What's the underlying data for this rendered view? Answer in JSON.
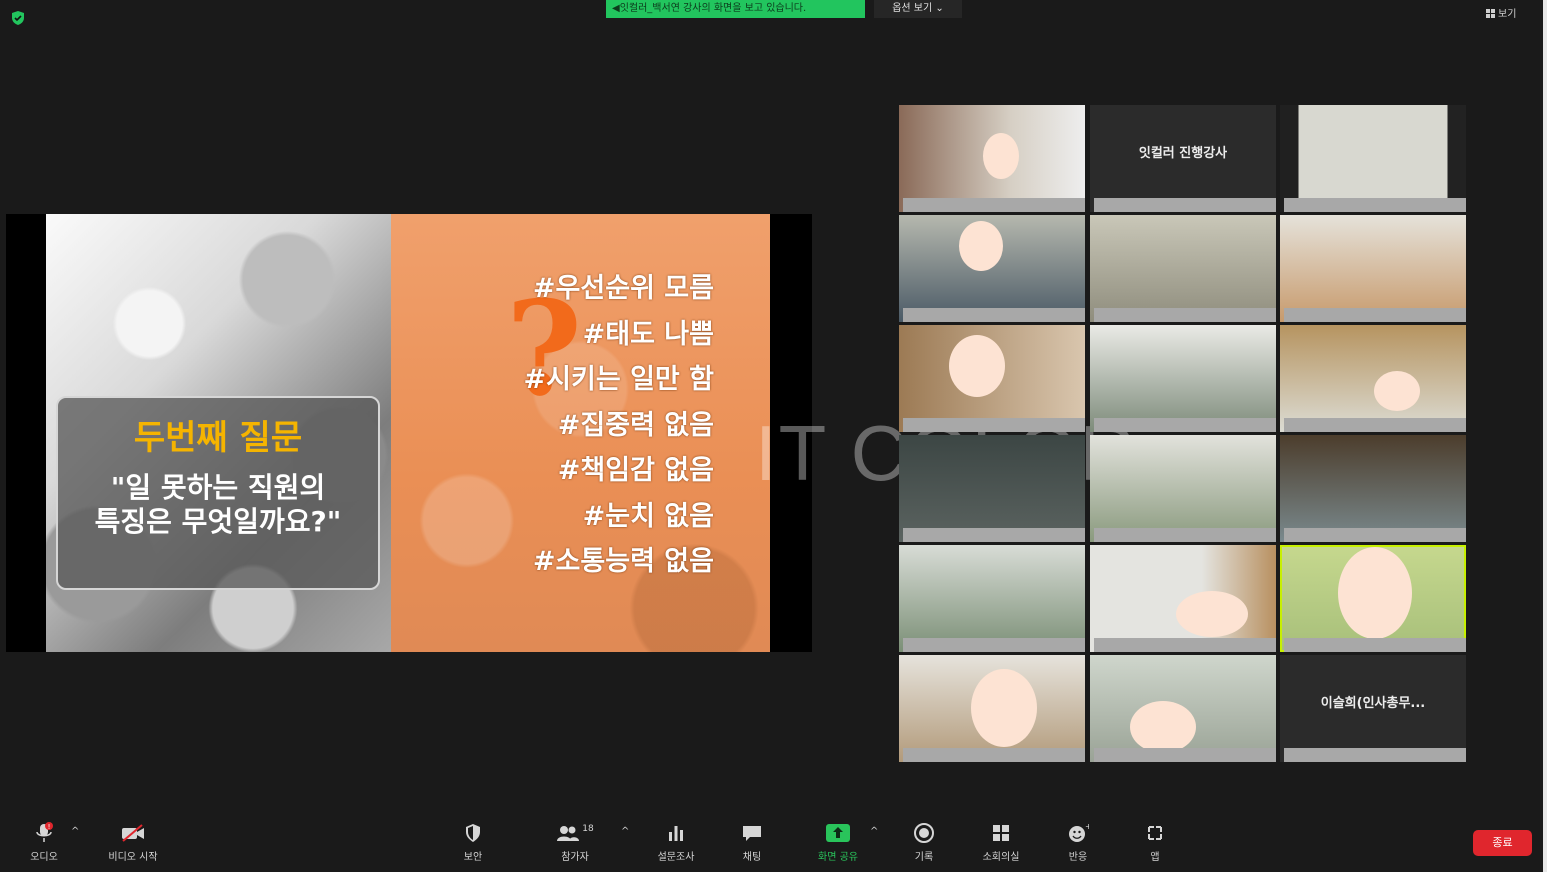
{
  "top": {
    "banner_text": "◀잇컬러_백서연 강사의 화면을 보고 있습니다.",
    "view_options_label": "옵션 보기 ⌄",
    "view_label": "보기"
  },
  "slide": {
    "question_title": "두번째 질문",
    "question_text": "\"일 못하는 직원의\n특징은 무엇일까요?\"",
    "hashtags": [
      "#우선순위 모름",
      "#태도 나쁨",
      "#시키는 일만 함",
      "#집중력 없음",
      "#책임감 없음",
      "#눈치 없음",
      "#소통능력 없음"
    ],
    "watermark": "IT COLOR",
    "accent_color": "#f26a1b",
    "title_color": "#f5b400"
  },
  "gallery": {
    "host_name": "잇컬러 진행강사",
    "participant_name": "이슬희(인사총무..."
  },
  "toolbar": {
    "audio": "오디오",
    "audio_badge": "!",
    "video": "비디오 시작",
    "security": "보안",
    "participants": "참가자",
    "participants_count": "18",
    "polls": "설문조사",
    "chat": "채팅",
    "share": "화면 공유",
    "record": "기록",
    "breakout": "소회의실",
    "reactions": "반응",
    "apps": "앱",
    "end": "종료",
    "share_color": "#29c45b",
    "end_color": "#e0262d"
  }
}
